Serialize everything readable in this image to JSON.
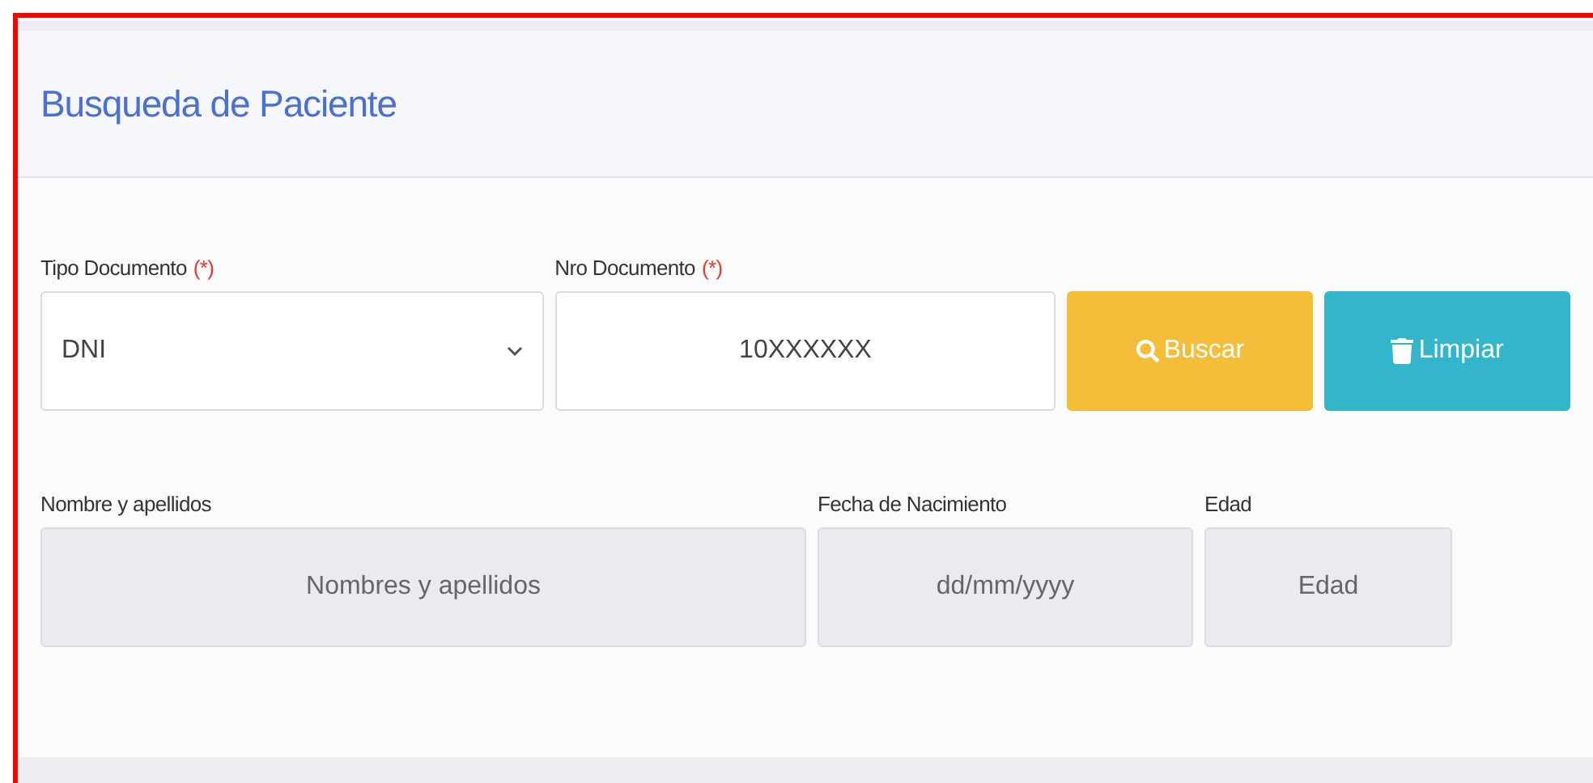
{
  "card": {
    "title": "Busqueda de Paciente"
  },
  "search_row": {
    "document_type": {
      "label": "Tipo Documento",
      "required_mark": "(*)",
      "value": "DNI"
    },
    "document_number": {
      "label": "Nro Documento",
      "required_mark": "(*)",
      "value": "10XXXXXX"
    },
    "buttons": [
      {
        "kind": "search",
        "label": "Buscar"
      },
      {
        "kind": "clear",
        "label": "Limpiar"
      }
    ]
  },
  "patient_row": [
    {
      "label": "Nombre y apellidos",
      "placeholder": "Nombres y apellidos",
      "disabled": true
    },
    {
      "label": "Fecha de Nacimiento",
      "placeholder": "dd/mm/yyyy",
      "disabled": true
    },
    {
      "label": "Edad",
      "placeholder": "Edad",
      "disabled": true
    }
  ]
}
